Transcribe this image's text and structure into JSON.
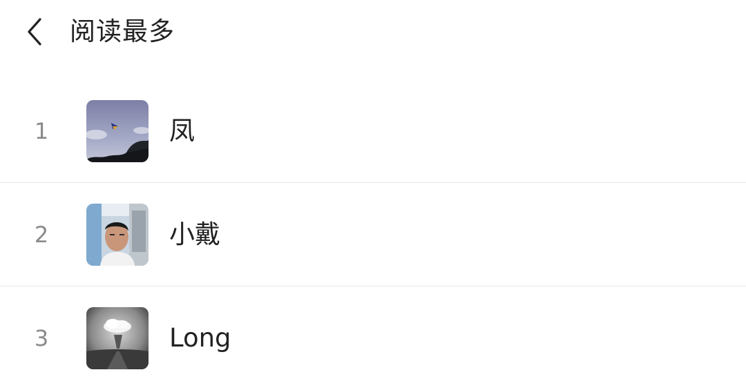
{
  "header": {
    "back_icon": "chevron-left-icon",
    "title": "阅读最多"
  },
  "ranking": [
    {
      "rank": "1",
      "name": "凤",
      "avatar": "kite-sky-avatar"
    },
    {
      "rank": "2",
      "name": "小戴",
      "avatar": "man-portrait-avatar"
    },
    {
      "rank": "3",
      "name": "Long",
      "avatar": "bw-cloud-figure-avatar"
    }
  ],
  "colors": {
    "text": "#222222",
    "rank": "#8a8a8a",
    "divider": "#e6e6e6",
    "background": "#ffffff"
  }
}
